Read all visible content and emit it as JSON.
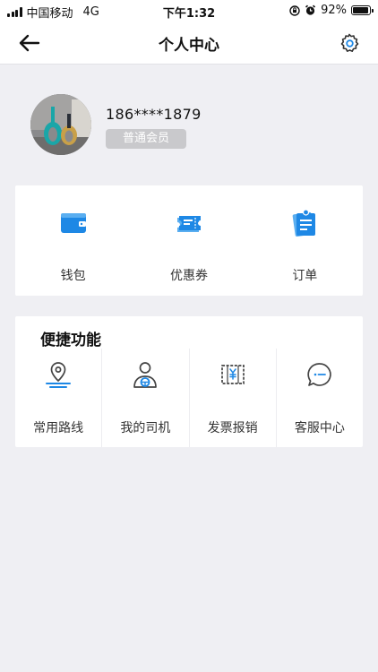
{
  "status_bar": {
    "carrier": "中国移动",
    "network": "4G",
    "time": "下午1:32",
    "battery": "92%",
    "battery_level": 0.92
  },
  "nav": {
    "title": "个人中心",
    "back_icon": "back-arrow-icon",
    "settings_icon": "gear-icon"
  },
  "profile": {
    "phone": "186****1879",
    "member_level": "普通会员"
  },
  "main_menu": [
    {
      "label": "钱包",
      "icon": "wallet-icon"
    },
    {
      "label": "优惠券",
      "icon": "coupon-icon"
    },
    {
      "label": "订单",
      "icon": "order-icon"
    }
  ],
  "quick_actions": {
    "title": "便捷功能",
    "items": [
      {
        "label": "常用路线",
        "icon": "location-pin-icon"
      },
      {
        "label": "我的司机",
        "icon": "driver-icon"
      },
      {
        "label": "发票报销",
        "icon": "invoice-icon"
      },
      {
        "label": "客服中心",
        "icon": "chat-bubble-icon"
      }
    ]
  },
  "colors": {
    "accent": "#1e88e5",
    "background": "#efeff3",
    "badge": "#c9c9cc"
  }
}
